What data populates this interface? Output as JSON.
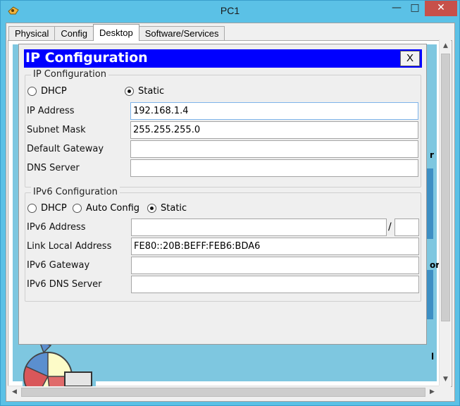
{
  "window": {
    "title": "PC1",
    "minimize": "—",
    "maximize": "□",
    "close": "✕"
  },
  "tabs": [
    {
      "label": "Physical",
      "active": false
    },
    {
      "label": "Config",
      "active": false
    },
    {
      "label": "Desktop",
      "active": true
    },
    {
      "label": "Software/Services",
      "active": false
    }
  ],
  "dialog": {
    "title": "IP Configuration",
    "close_label": "X",
    "ipv4": {
      "legend": "IP Configuration",
      "dhcp_label": "DHCP",
      "static_label": "Static",
      "selected": "Static",
      "ip_label": "IP Address",
      "ip_value": "192.168.1.4",
      "mask_label": "Subnet Mask",
      "mask_value": "255.255.255.0",
      "gateway_label": "Default Gateway",
      "gateway_value": "",
      "dns_label": "DNS Server",
      "dns_value": ""
    },
    "ipv6": {
      "legend": "IPv6 Configuration",
      "dhcp_label": "DHCP",
      "auto_label": "Auto Config",
      "static_label": "Static",
      "selected": "Static",
      "address_label": "IPv6 Address",
      "address_value": "",
      "prefix_separator": "/",
      "prefix_value": "",
      "link_local_label": "Link Local Address",
      "link_local_value": "FE80::20B:BEFF:FEB6:BDA6",
      "gateway_label": "IPv6 Gateway",
      "gateway_value": "",
      "dns_label": "IPv6 DNS Server",
      "dns_value": ""
    }
  },
  "desktop_partial_labels": {
    "right_label_1": "r",
    "right_label_2": "or",
    "right_label_3": "l"
  }
}
